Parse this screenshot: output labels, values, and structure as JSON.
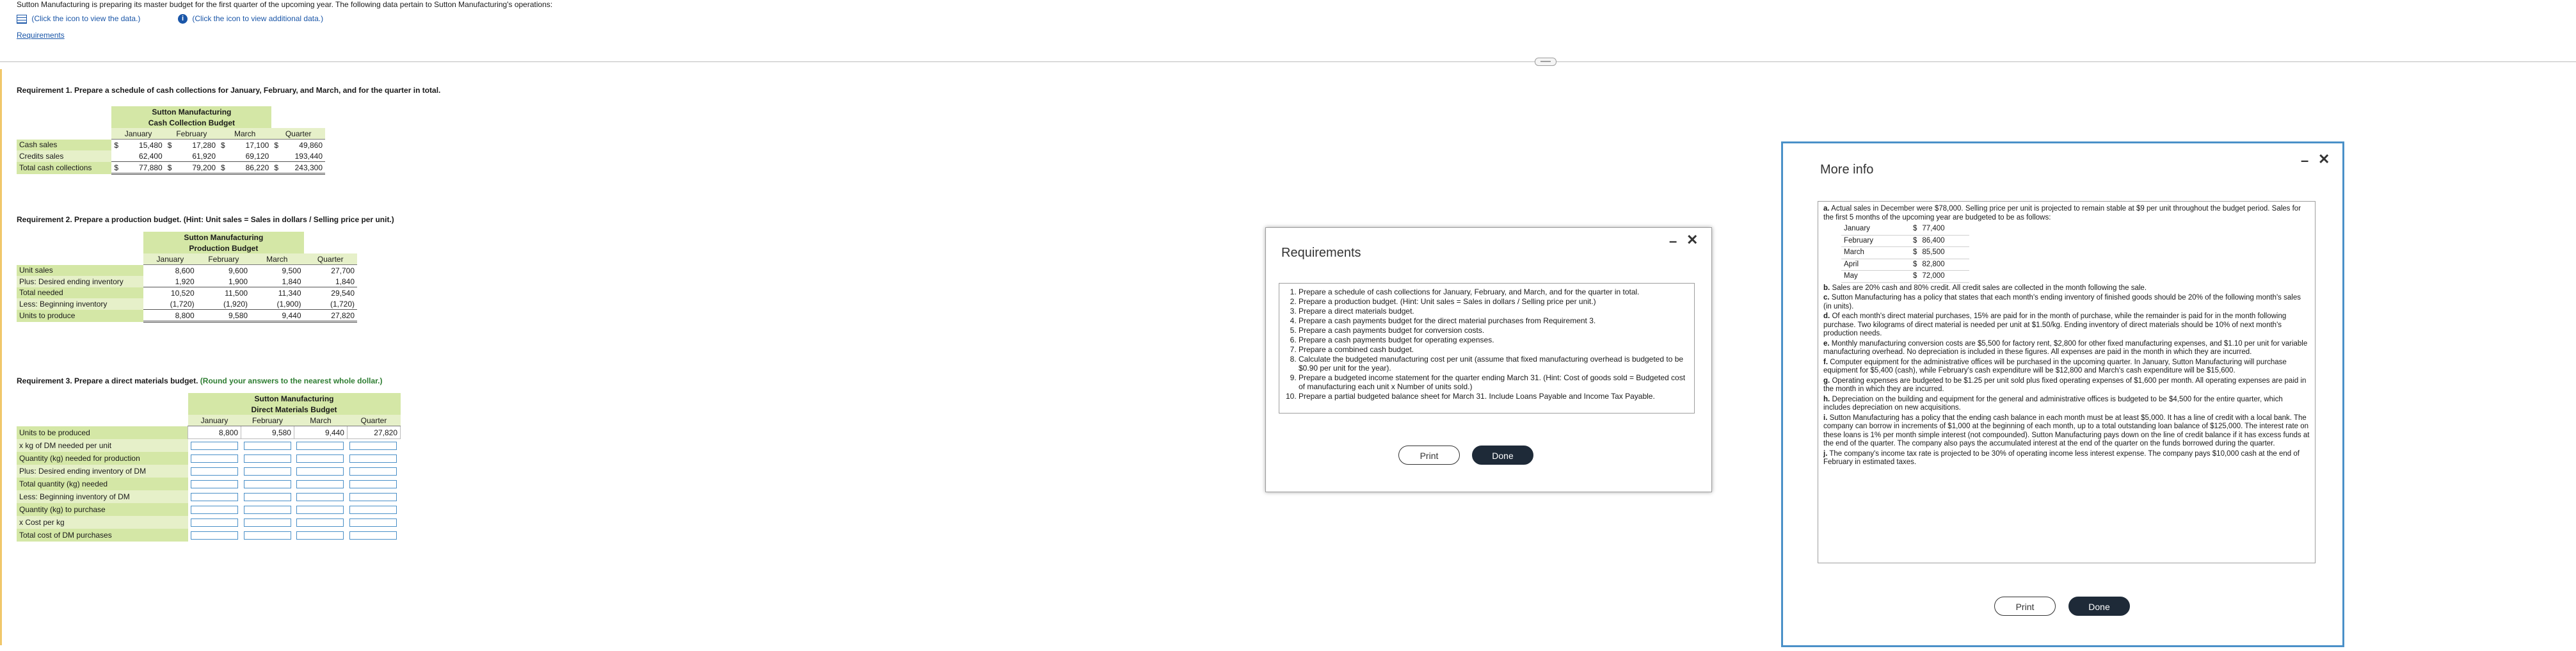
{
  "header": {
    "intro": "Sutton Manufacturing is preparing its master budget for the first quarter of the upcoming year. The following data pertain to Sutton Manufacturing's operations:",
    "link_data": "(Click the icon to view the data.)",
    "link_info": "(Click the icon to view additional data.)",
    "requirements_link": "Requirements"
  },
  "req1": {
    "prompt": "Requirement 1. Prepare a schedule of cash collections for January, February, and March, and for the quarter in total.",
    "company": "Sutton Manufacturing",
    "title": "Cash Collection Budget",
    "cols": [
      "January",
      "February",
      "March",
      "Quarter"
    ],
    "rows": [
      {
        "label": "Cash sales",
        "dollar": true,
        "values": [
          "15,480",
          "17,280",
          "17,100",
          "49,860"
        ]
      },
      {
        "label": "Credits sales",
        "dollar": false,
        "values": [
          "62,400",
          "61,920",
          "69,120",
          "193,440"
        ]
      },
      {
        "label": "Total cash collections",
        "dollar": true,
        "values": [
          "77,880",
          "79,200",
          "86,220",
          "243,300"
        ]
      }
    ]
  },
  "req2": {
    "prompt": "Requirement 2. Prepare a production budget. (Hint: Unit sales = Sales in dollars / Selling price per unit.)",
    "company": "Sutton Manufacturing",
    "title": "Production Budget",
    "cols": [
      "January",
      "February",
      "March",
      "Quarter"
    ],
    "rows": [
      {
        "label": "Unit sales",
        "values": [
          "8,600",
          "9,600",
          "9,500",
          "27,700"
        ]
      },
      {
        "label": "Plus: Desired ending inventory",
        "values": [
          "1,920",
          "1,900",
          "1,840",
          "1,840"
        ]
      },
      {
        "label": "Total needed",
        "values": [
          "10,520",
          "11,500",
          "11,340",
          "29,540"
        ]
      },
      {
        "label": "Less: Beginning inventory",
        "values": [
          "(1,720)",
          "(1,920)",
          "(1,900)",
          "(1,720)"
        ]
      },
      {
        "label": "Units to produce",
        "values": [
          "8,800",
          "9,580",
          "9,440",
          "27,820"
        ]
      }
    ]
  },
  "req3": {
    "prompt": "Requirement 3. Prepare a direct materials budget.",
    "hint": "(Round your answers to the nearest whole dollar.)",
    "company": "Sutton Manufacturing",
    "title": "Direct Materials Budget",
    "cols": [
      "January",
      "February",
      "March",
      "Quarter"
    ],
    "first_row": {
      "label": "Units to be produced",
      "values": [
        "8,800",
        "9,580",
        "9,440",
        "27,820"
      ]
    },
    "input_rows": [
      "x kg of DM needed per unit",
      "Quantity (kg) needed for production",
      "Plus: Desired ending inventory of DM",
      "Total quantity (kg) needed",
      "Less: Beginning inventory of DM",
      "Quantity (kg) to purchase",
      "x Cost per kg",
      "Total cost of DM purchases"
    ]
  },
  "requirements_modal": {
    "title": "Requirements",
    "items": [
      "Prepare a schedule of cash collections for January, February, and March, and for the quarter in total.",
      "Prepare a production budget. (Hint: Unit sales = Sales in dollars / Selling price per unit.)",
      "Prepare a direct materials budget.",
      "Prepare a cash payments budget for the direct material purchases from Requirement 3.",
      "Prepare a cash payments budget for conversion costs.",
      "Prepare a cash payments budget for operating expenses.",
      "Prepare a combined cash budget.",
      "Calculate the budgeted manufacturing cost per unit (assume that fixed manufacturing overhead is budgeted to be $0.90 per unit for the year).",
      "Prepare a budgeted income statement for the quarter ending March 31. (Hint: Cost of goods sold = Budgeted cost of manufacturing each unit x Number of units sold.)",
      "Prepare a partial budgeted balance sheet for March 31. Include Loans Payable and Income Tax Payable."
    ],
    "print": "Print",
    "done": "Done"
  },
  "info_modal": {
    "title": "More info",
    "a_text": "Actual sales in December were $78,000. Selling price per unit is projected to remain stable at $9 per unit throughout the budget period. Sales for the first 5 months of the upcoming year are budgeted to be as follows:",
    "sales": [
      {
        "month": "January",
        "amount": "77,400"
      },
      {
        "month": "February",
        "amount": "86,400"
      },
      {
        "month": "March",
        "amount": "85,500"
      },
      {
        "month": "April",
        "amount": "82,800"
      },
      {
        "month": "May",
        "amount": "72,000"
      }
    ],
    "items": [
      {
        "letter": "b.",
        "text": "Sales are 20% cash and 80% credit. All credit sales are collected in the month following the sale."
      },
      {
        "letter": "c.",
        "text": "Sutton Manufacturing has a policy that states that each month's ending inventory of finished goods should be 20% of the following month's sales (in units)."
      },
      {
        "letter": "d.",
        "text": "Of each month's direct material purchases, 15% are paid for in the month of purchase, while the remainder is paid for in the month following purchase. Two kilograms of direct material is needed per unit at $1.50/kg. Ending inventory of direct materials should be 10% of next month's production needs."
      },
      {
        "letter": "e.",
        "text": "Monthly manufacturing conversion costs are $5,500 for factory rent, $2,800 for other fixed manufacturing expenses, and $1.10 per unit for variable manufacturing overhead. No depreciation is included in these figures. All expenses are paid in the month in which they are incurred."
      },
      {
        "letter": "f.",
        "text": "Computer equipment for the administrative offices will be purchased in the upcoming quarter. In January, Sutton Manufacturing will purchase equipment for $5,400 (cash), while February's cash expenditure will be $12,800 and March's cash expenditure will be $15,600."
      },
      {
        "letter": "g.",
        "text": "Operating expenses are budgeted to be $1.25 per unit sold plus fixed operating expenses of $1,600 per month. All operating expenses are paid in the month in which they are incurred."
      },
      {
        "letter": "h.",
        "text": "Depreciation on the building and equipment for the general and administrative offices is budgeted to be $4,500 for the entire quarter, which includes depreciation on new acquisitions."
      },
      {
        "letter": "i.",
        "text": "Sutton Manufacturing has a policy that the ending cash balance in each month must be at least $5,000. It has a line of credit with a local bank. The company can borrow in increments of $1,000 at the beginning of each month, up to a total outstanding loan balance of $125,000. The interest rate on these loans is 1% per month simple interest (not compounded). Sutton Manufacturing pays down on the line of credit balance if it has excess funds at the end of the quarter. The company also pays the accumulated interest at the end of the quarter on the funds borrowed during the quarter."
      },
      {
        "letter": "j.",
        "text": "The company's income tax rate is projected to be 30% of operating income less interest expense. The company pays $10,000 cash at the end of February in estimated taxes."
      }
    ],
    "print": "Print",
    "done": "Done"
  },
  "colors": {
    "green": "#d4e7a6",
    "accent": "#1a56a8",
    "done_bg": "#1e2a38",
    "info_border": "#4a90c8"
  }
}
